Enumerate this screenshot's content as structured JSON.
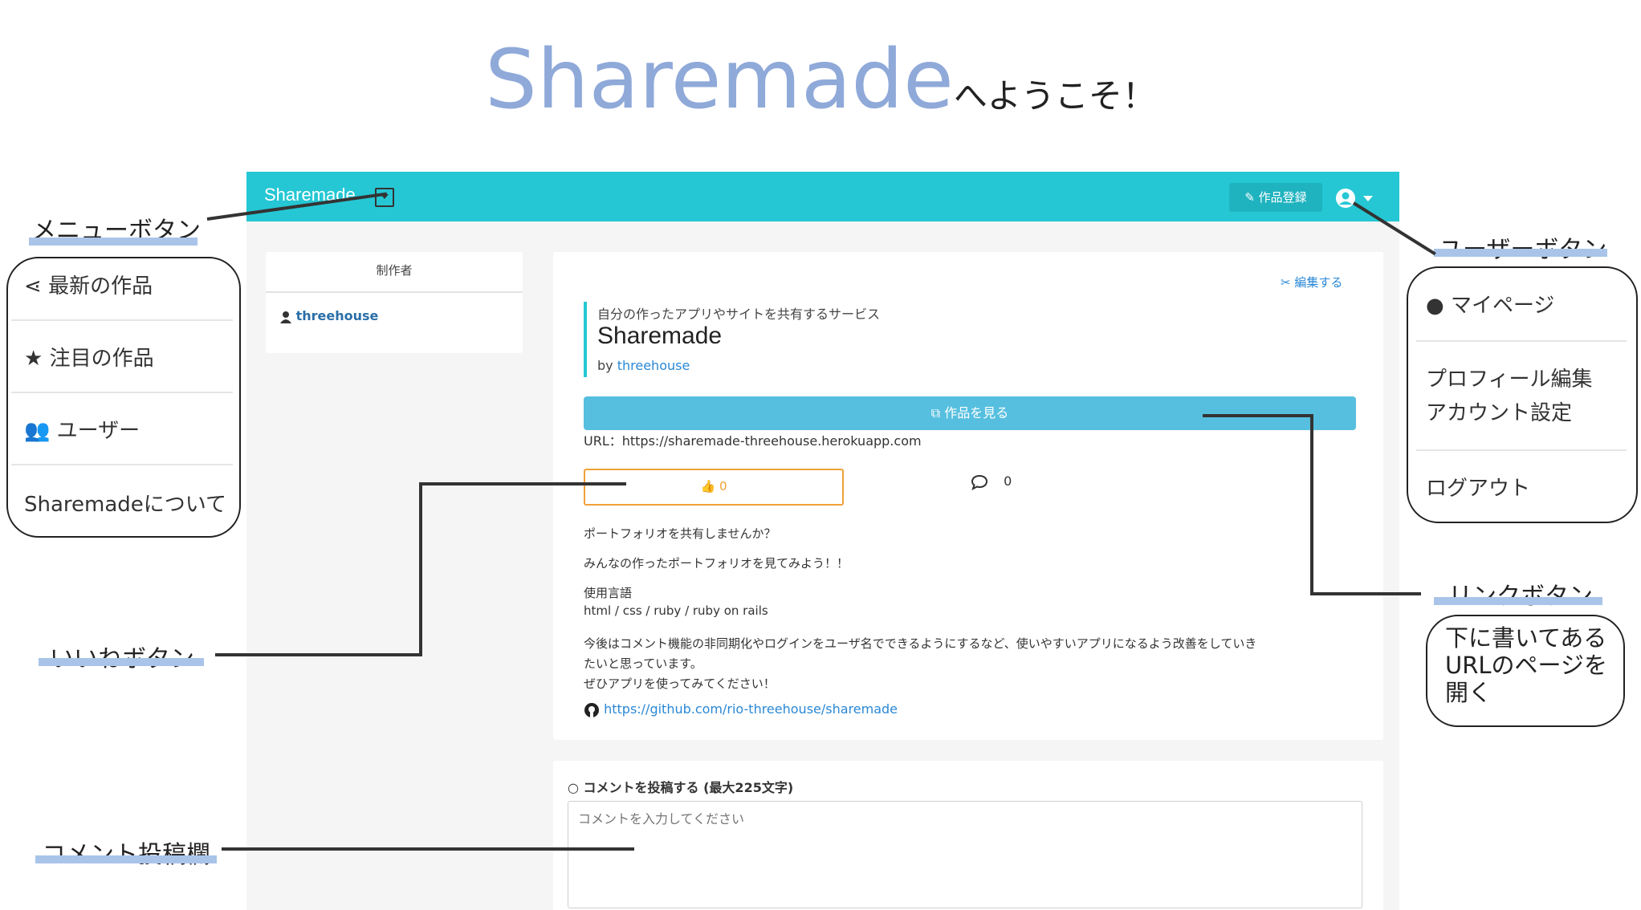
{
  "hero": {
    "brand": "Sharemade",
    "suffix": "へようこそ！"
  },
  "app": {
    "nav": {
      "brand": "Sharemade",
      "register": "作品登録"
    },
    "creator": {
      "heading": "制作者",
      "name": "threehouse"
    },
    "work": {
      "edit": "編集する",
      "subtitle": "自分の作ったアプリやサイトを共有するサービス",
      "title": "Sharemade",
      "by_label": "by",
      "by_user": "threehouse",
      "view_button": "作品を見る",
      "url_line": "URL：https://sharemade-threehouse.herokuapp.com",
      "likes": "0",
      "comments": "0",
      "desc1": "ポートフォリオを共有しませんか？",
      "desc2": "みんなの作ったポートフォリオを見てみよう！！",
      "lang_label": "使用言語",
      "lang_value": "html / css / ruby / ruby on rails",
      "long_desc_1": "今後はコメント機能の非同期化やログインをユーザ名でできるようにするなど、使いやすいアプリになるよう改善をしていき",
      "long_desc_2": "たいと思っています。",
      "long_desc_3": "ぜひアプリを使ってみてください！",
      "github": "https://github.com/rio-threehouse/sharemade"
    },
    "comment": {
      "label": "コメントを投稿する (最大225文字)",
      "placeholder": "コメントを入力してください"
    }
  },
  "annotations": {
    "menu_button": "メニューボタン",
    "user_button": "ユーザーボタン",
    "like_button": "いいねボタン",
    "link_button": "リンクボタン",
    "comment_area": "コメント投稿欄",
    "link_note_1": "下に書いてある",
    "link_note_2": "URLのページを",
    "link_note_3": "開く"
  },
  "left_menu": [
    "最新の作品",
    "注目の作品",
    "ユーザー",
    "Sharemadeについて"
  ],
  "right_menu": [
    "マイページ",
    "プロフィール編集",
    "アカウント設定",
    "ログアウト"
  ],
  "colors": {
    "accent": "#25c7d4",
    "brand_title": "#8fa9d9",
    "like": "#f0a138",
    "link": "#2a88d6",
    "highlight": "#a9c4e8"
  }
}
